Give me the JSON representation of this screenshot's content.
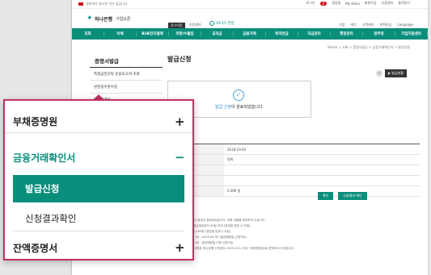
{
  "notice": {
    "text": "생명보다 중요한 것은 없습니다"
  },
  "toplinks": {
    "l1": "로그인",
    "badge": "0",
    "l2": "영업점",
    "l3": "My Hana",
    "l4": "회원가입",
    "l5": "인증센터",
    "l6": "즐겨찾기",
    "lang": "Language"
  },
  "header": {
    "logo_mark": "✦",
    "logo_name": "하나은행",
    "logo_sub": "기업오픈",
    "login_label": "로그아웃",
    "center_label": "인증센터",
    "timer": "19:15 연장"
  },
  "header_links": [
    "기업",
    "개인",
    "고객센터",
    "퇴직연금",
    "Language"
  ],
  "nav": [
    "조회",
    "이체",
    "B2B전자결제",
    "외환/수출입",
    "공과금",
    "금융거래",
    "퇴직연금",
    "자금관리",
    "행정관리",
    "정부정",
    "기업지원센터"
  ],
  "breadcrumb": "Home > 조회 > 증명서발급 > 금융거래확인서 > 발급신청",
  "lnb": {
    "title": "증명서발급",
    "items": [
      "특정금전신탁 운용보고서 조회",
      "원천징수영수증",
      "부채증명원"
    ]
  },
  "page": {
    "title": "발급신청",
    "help": "?",
    "print_label": "▶ 발급현황"
  },
  "done": {
    "check": "✓",
    "highlight": "발급 신청",
    "rest": "이 완료되었습니다."
  },
  "table": [
    {
      "value": "2018-10-03"
    },
    {
      "value": "원화"
    },
    {
      "value": ""
    },
    {
      "value": ""
    },
    {
      "value": "2,000 원"
    }
  ],
  "buttons": {
    "confirm": "확인",
    "result": "신청결과 확인"
  },
  "notes": [
    "고객님, 증명서 발급이 완료되었습니다. 아래 내용을 확인하여 주십시오.",
    "1. 발급일 : 발급일로부터 30일 이내 (영업점 방문 시 지참)",
    "2. 수수료 : 2,000원 (영업점 방문시 지참)",
    "3. 2016.06.30 : 2016.06.30 (발급예정일 신청가능)",
    "4. 2016.06.30 : 발급예정일 이후 신청가능",
    "5. 기타 문의사항은 하나은행 고객센터 1599-1111 또는 거래영업점으로 문의하시기 바랍니다."
  ],
  "zoom": {
    "item1": "부채증명원",
    "item1_sign": "+",
    "item2": "금융거래확인서",
    "item2_sign": "−",
    "sub_selected": "발급신청",
    "sub_other": "신청결과확인",
    "item3": "잔액증명서",
    "item3_sign": "+"
  },
  "colors": {
    "brand": "#0a8e7c",
    "highlight_border": "#c4305e",
    "accent_blue": "#2a8fc8"
  }
}
